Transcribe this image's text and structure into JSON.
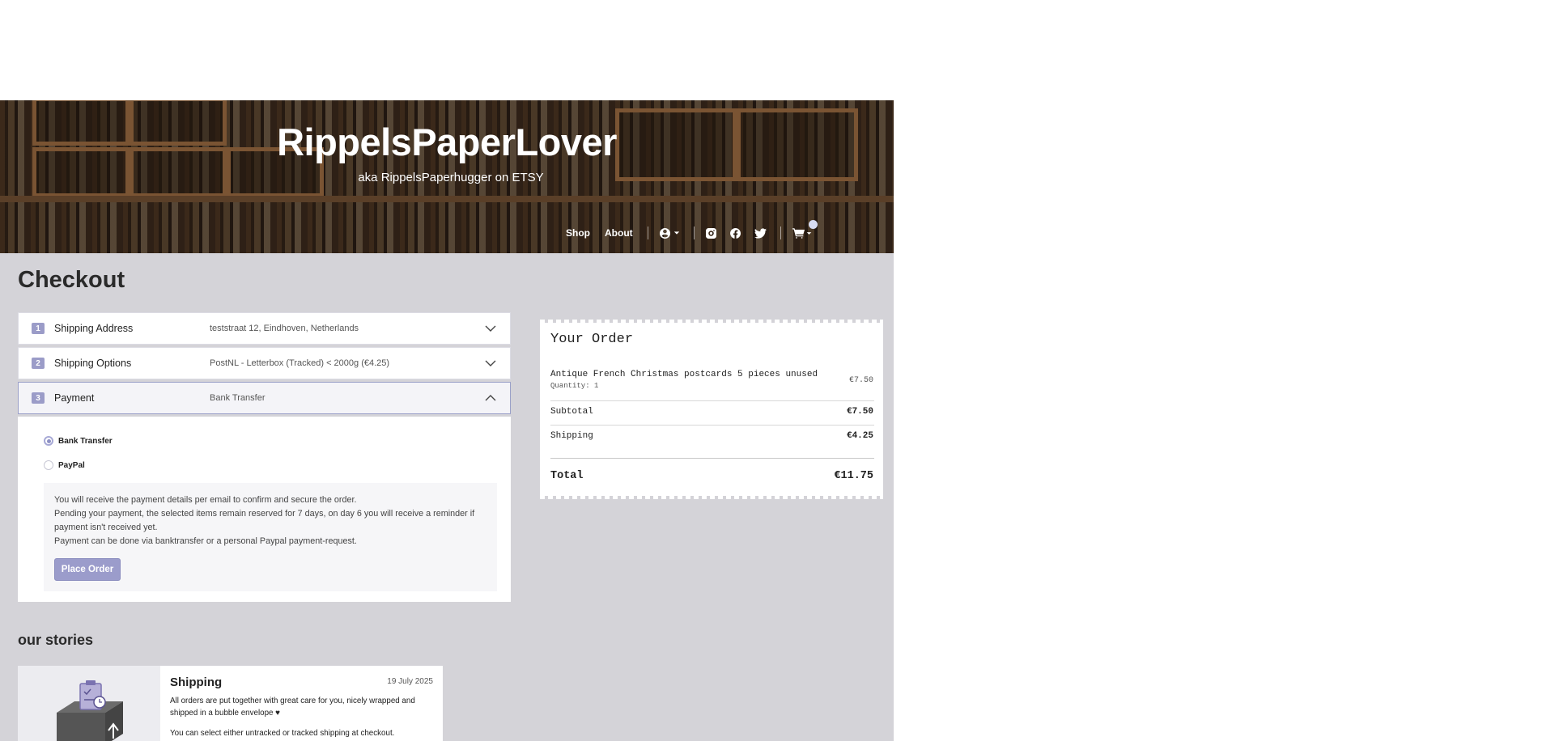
{
  "site": {
    "title": "RippelsPaperLover",
    "subtitle": "aka RippelsPaperhugger on ETSY"
  },
  "nav": {
    "links": [
      "Shop",
      "About"
    ],
    "icons": [
      "user-circle-icon",
      "chevron-down-icon",
      "instagram-icon",
      "facebook-icon",
      "twitter-icon",
      "cart-icon"
    ]
  },
  "checkout": {
    "title": "Checkout",
    "steps": [
      {
        "number": "1",
        "label": "Shipping Address",
        "value": "teststraat 12, Eindhoven, Netherlands",
        "expanded": false
      },
      {
        "number": "2",
        "label": "Shipping Options",
        "value": "PostNL - Letterbox (Tracked) < 2000g (€4.25)",
        "expanded": false
      },
      {
        "number": "3",
        "label": "Payment",
        "value": "Bank Transfer",
        "expanded": true
      }
    ],
    "payment": {
      "options": [
        {
          "label": "Bank Transfer",
          "selected": true
        },
        {
          "label": "PayPal",
          "selected": false
        }
      ],
      "info": [
        "You will receive the payment details per email to confirm and secure the order.",
        "Pending your payment, the selected items remain reserved for 7 days, on day 6 you will receive a reminder if payment isn't received yet.",
        "Payment can be done via banktransfer or  a personal Paypal payment-request."
      ],
      "button": "Place Order"
    }
  },
  "order": {
    "title": "Your Order",
    "item": {
      "name": "Antique French Christmas postcards 5 pieces unused",
      "quantity": "Quantity: 1",
      "price": "€7.50"
    },
    "subtotal_label": "Subtotal",
    "subtotal": "€7.50",
    "shipping_label": "Shipping",
    "shipping": "€4.25",
    "total_label": "Total",
    "total": "€11.75"
  },
  "stories": {
    "title": "our stories",
    "card": {
      "title": "Shipping",
      "date": "19 July 2025",
      "text1": "All orders are put together with great care for you, nicely wrapped and shipped in a bubble envelope ♥",
      "text2": "You can select either untracked or tracked shipping at checkout."
    }
  },
  "colors": {
    "accent": "#9b9ccb",
    "page_background": "#d4d3d8"
  }
}
